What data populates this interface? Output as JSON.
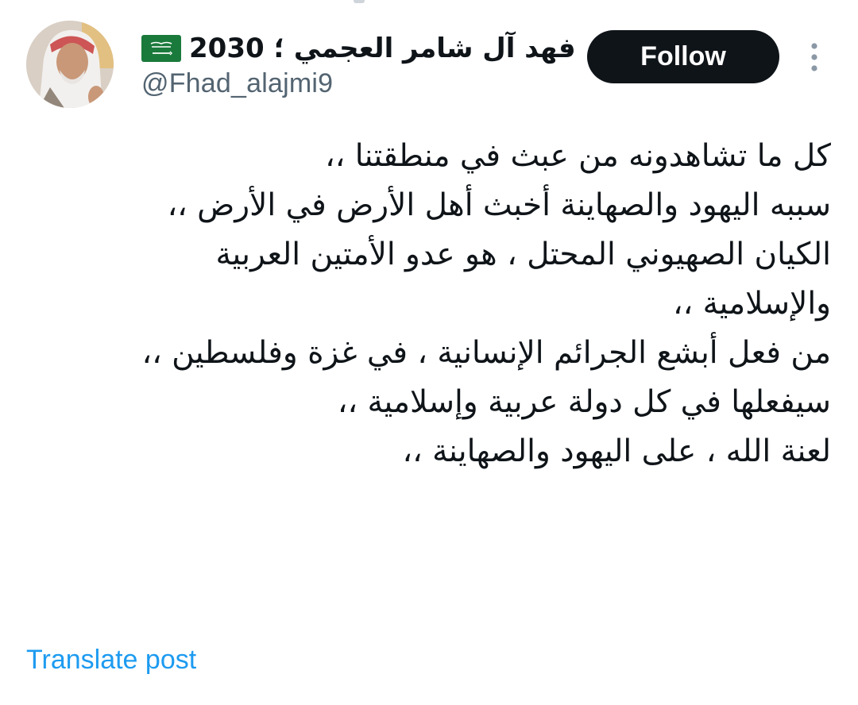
{
  "author": {
    "display_name": "فهد آل شامر العجمي ؛ 2030",
    "flag_icon": "saudi-flag-icon",
    "handle": "@Fhad_alajmi9"
  },
  "actions": {
    "follow_label": "Follow",
    "more_icon": "more-vertical-icon",
    "translate_label": "Translate post"
  },
  "tweet": {
    "lines": [
      "كل ما تشاهدونه من عبث في منطقتنا ،،",
      "سببه اليهود والصهاينة أخبث أهل الأرض في الأرض ،،",
      "الكيان الصهيوني المحتل ، هو عدو الأمتين العربية",
      "والإسلامية ،،",
      "من فعل أبشع الجرائم الإنسانية ، في غزة وفلسطين ،،",
      "سيفعلها في كل دولة عربية وإسلامية ،،",
      "لعنة الله ، على اليهود والصهاينة ،،"
    ]
  },
  "colors": {
    "text_primary": "#0f1419",
    "text_secondary": "#536471",
    "link": "#1d9bf0",
    "follow_bg": "#0f1419",
    "follow_text": "#ffffff",
    "flag_green": "#1a7a3c"
  }
}
